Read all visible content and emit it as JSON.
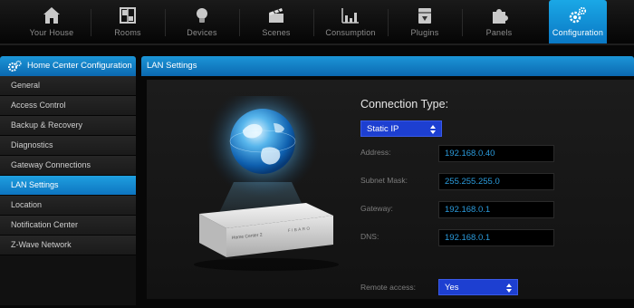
{
  "nav": {
    "items": [
      {
        "label": "Your House",
        "icon": "house-icon"
      },
      {
        "label": "Rooms",
        "icon": "rooms-icon"
      },
      {
        "label": "Devices",
        "icon": "lightbulb-icon"
      },
      {
        "label": "Scenes",
        "icon": "clapperboard-icon"
      },
      {
        "label": "Consumption",
        "icon": "bar-chart-icon"
      },
      {
        "label": "Plugins",
        "icon": "plugin-box-icon"
      },
      {
        "label": "Panels",
        "icon": "puzzle-icon"
      },
      {
        "label": "Configuration",
        "icon": "gears-icon"
      }
    ],
    "active": "Configuration"
  },
  "sidebar": {
    "title": "Home Center Configuration",
    "items": [
      {
        "label": "General"
      },
      {
        "label": "Access Control"
      },
      {
        "label": "Backup & Recovery"
      },
      {
        "label": "Diagnostics"
      },
      {
        "label": "Gateway Connections"
      },
      {
        "label": "LAN Settings"
      },
      {
        "label": "Location"
      },
      {
        "label": "Notification Center"
      },
      {
        "label": "Z-Wave Network"
      }
    ],
    "active": "LAN Settings"
  },
  "panel": {
    "title": "LAN Settings",
    "device_label": "Home Center 2",
    "device_brand": "FIBARO",
    "connection_type_label": "Connection Type:",
    "connection_type_value": "Static IP",
    "fields": {
      "address": {
        "label": "Address:",
        "value": "192.168.0.40"
      },
      "subnet": {
        "label": "Subnet Mask:",
        "value": "255.255.255.0"
      },
      "gateway": {
        "label": "Gateway:",
        "value": "192.168.0.1"
      },
      "dns": {
        "label": "DNS:",
        "value": "192.168.0.1"
      }
    },
    "remote_access_label": "Remote access:",
    "remote_access_value": "Yes"
  },
  "colors": {
    "accent": "#1a8fd6",
    "select_bg": "#1d3fd1",
    "field_text": "#2b9bdc",
    "background": "#070707"
  }
}
